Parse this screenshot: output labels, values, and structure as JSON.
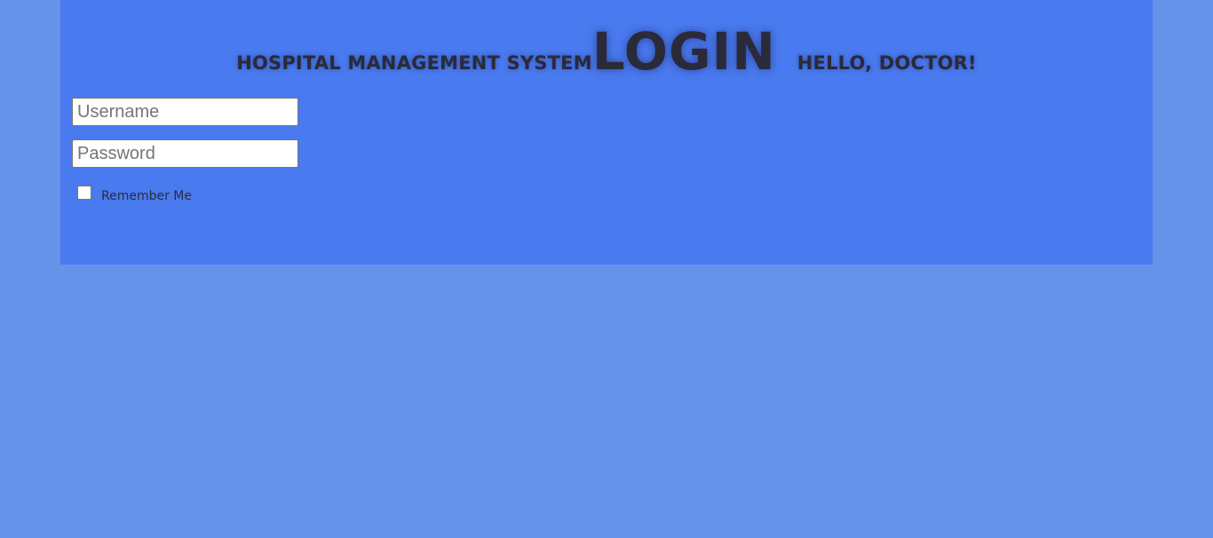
{
  "header": {
    "system_title": "HOSPITAL MANAGEMENT SYSTEM",
    "login_title": "LOGIN",
    "greeting": "HELLO, DOCTOR!"
  },
  "form": {
    "username_placeholder": "Username",
    "username_value": "",
    "password_placeholder": "Password",
    "password_value": "",
    "remember_label": "Remember Me",
    "remember_checked": false
  },
  "colors": {
    "page_background": "#6593e9",
    "panel_background": "#4a7af0",
    "heading_text": "#2a2a3a"
  }
}
